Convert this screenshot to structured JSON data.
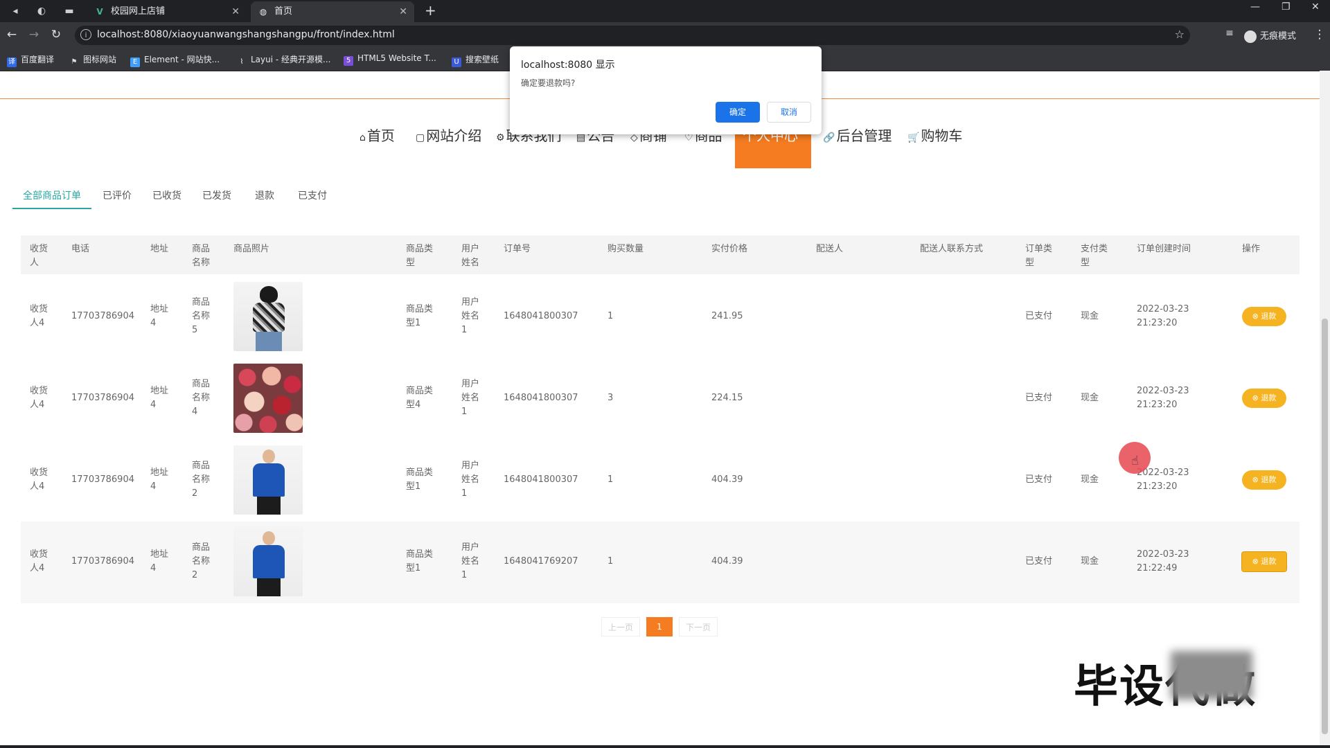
{
  "browser": {
    "tabs": [
      {
        "title": "校园网上店铺",
        "icon": "vue-icon"
      },
      {
        "title": "首页",
        "icon": "globe-icon"
      }
    ],
    "url": "localhost:8080/xiaoyuanwangshangshangpu/front/index.html",
    "incognito_label": "无痕模式",
    "bookmarks": [
      "百度翻译",
      "图标网站",
      "Element - 网站快...",
      "Layui - 经典开源模...",
      "HTML5 Website T...",
      "搜索壁纸"
    ]
  },
  "dialog": {
    "title": "localhost:8080 显示",
    "message": "确定要退款吗?",
    "ok_label": "确定",
    "cancel_label": "取消"
  },
  "nav": {
    "items": [
      {
        "icon": "⌂",
        "label": "首页"
      },
      {
        "icon": "▢",
        "label": "网站介绍"
      },
      {
        "icon": "⚙",
        "label": "联系我们"
      },
      {
        "icon": "▤",
        "label": "公告"
      },
      {
        "icon": "◇",
        "label": "商铺"
      },
      {
        "icon": "♡",
        "label": "商品"
      },
      {
        "icon": "",
        "label": "个人中心"
      },
      {
        "icon": "🔗",
        "label": "后台管理"
      },
      {
        "icon": "🛒",
        "label": "购物车"
      }
    ]
  },
  "subtabs": [
    "全部商品订单",
    "已评价",
    "已收货",
    "已发货",
    "退款",
    "已支付"
  ],
  "table": {
    "headers": [
      "收货\n人",
      "电话",
      "地址",
      "商品\n名称",
      "商品照片",
      "商品类\n型",
      "用户\n姓名",
      "订单号",
      "购买数量",
      "实付价格",
      "配送人",
      "配送人联系方式",
      "订单类\n型",
      "支付类\n型",
      "订单创建时间",
      "操作"
    ],
    "action_label": "退款",
    "rows": [
      {
        "receiver": "收货\n人4",
        "phone": "17703786904",
        "address": "地址\n4",
        "product": "商品\n名称\n5",
        "image": "woman-fashion-photo",
        "type": "商品类\n型1",
        "user": "用户\n姓名\n1",
        "order_no": "1648041800307",
        "qty": "1",
        "price": "241.95",
        "courier": "",
        "courier_contact": "",
        "order_type": "已支付",
        "pay_type": "现金",
        "created": "2022-03-23\n21:23:20"
      },
      {
        "receiver": "收货\n人4",
        "phone": "17703786904",
        "address": "地址\n4",
        "product": "商品\n名称\n4",
        "image": "roses-bouquet-photo",
        "type": "商品类\n型4",
        "user": "用户\n姓名\n1",
        "order_no": "1648041800307",
        "qty": "3",
        "price": "224.15",
        "courier": "",
        "courier_contact": "",
        "order_type": "已支付",
        "pay_type": "现金",
        "created": "2022-03-23\n21:23:20"
      },
      {
        "receiver": "收货\n人4",
        "phone": "17703786904",
        "address": "地址\n4",
        "product": "商品\n名称\n2",
        "image": "man-blue-sweater-photo",
        "type": "商品类\n型1",
        "user": "用户\n姓名\n1",
        "order_no": "1648041800307",
        "qty": "1",
        "price": "404.39",
        "courier": "",
        "courier_contact": "",
        "order_type": "已支付",
        "pay_type": "现金",
        "created": "2022-03-23\n21:23:20"
      },
      {
        "receiver": "收货\n人4",
        "phone": "17703786904",
        "address": "地址\n4",
        "product": "商品\n名称\n2",
        "image": "man-blue-sweater-photo",
        "type": "商品类\n型1",
        "user": "用户\n姓名\n1",
        "order_no": "1648041769207",
        "qty": "1",
        "price": "404.39",
        "courier": "",
        "courier_contact": "",
        "order_type": "已支付",
        "pay_type": "现金",
        "created": "2022-03-23\n21:22:49"
      }
    ]
  },
  "pagination": {
    "prev": "上一页",
    "current": "1",
    "next": "下一页"
  },
  "watermark": "毕设代做",
  "colors": {
    "accent": "#f57c20",
    "teal": "#2aa6a0",
    "refund": "#f6b321",
    "dialog_ok": "#1a73e8"
  }
}
